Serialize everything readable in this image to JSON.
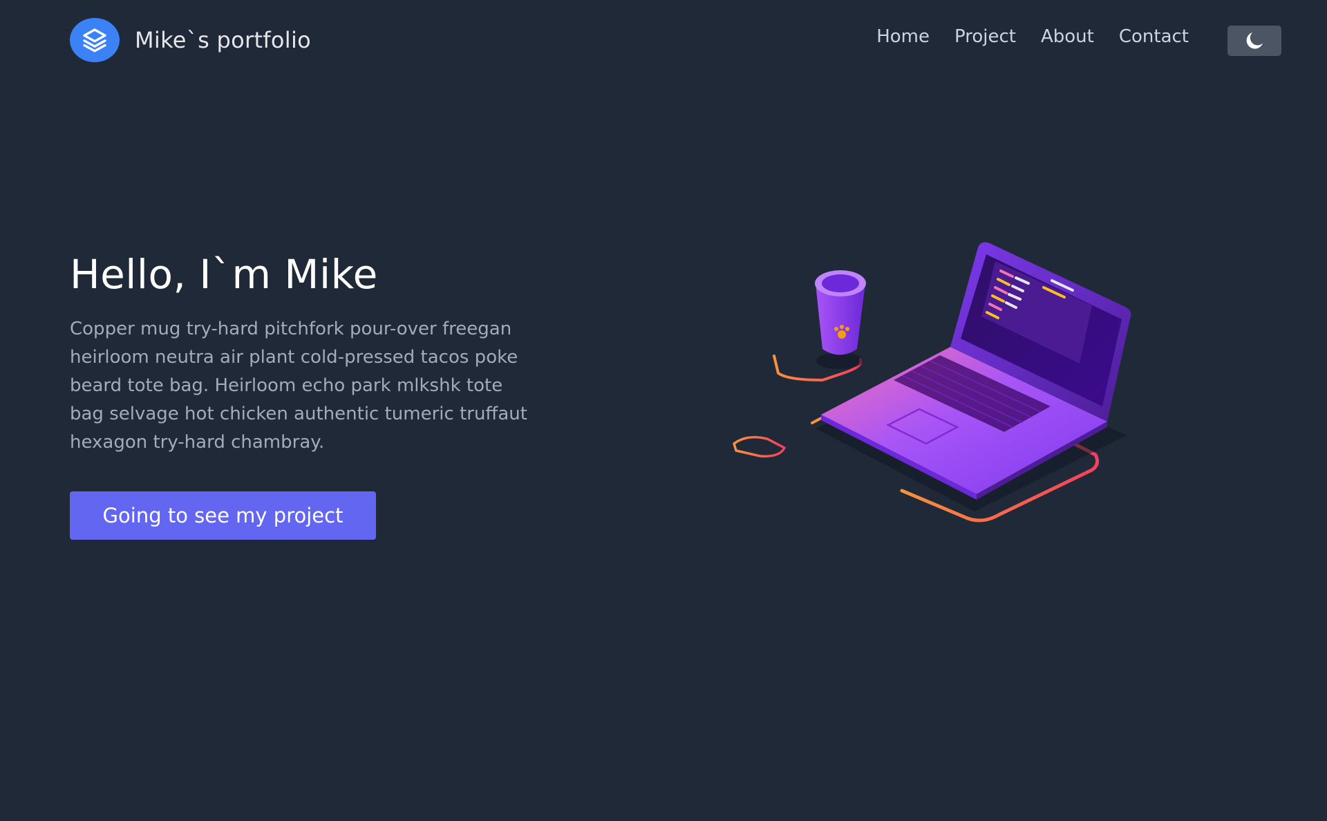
{
  "header": {
    "logo_text": "Mike`s portfolio",
    "nav": [
      "Home",
      "Project",
      "About",
      "Contact"
    ],
    "theme_toggle_icon": "moon-icon"
  },
  "hero": {
    "title": "Hello, I`m Mike",
    "description": "Copper mug try-hard pitchfork pour-over freegan heirloom neutra air plant cold-pressed tacos poke beard tote bag. Heirloom echo park mlkshk tote bag selvage hot chicken authentic tumeric truffaut hexagon try-hard chambray.",
    "cta_label": "Going to see my project",
    "illustration": "laptop-and-coffee-cup-illustration"
  },
  "colors": {
    "background": "#1f2937",
    "logo": "#3b82f6",
    "cta": "#6366f1",
    "toggle": "#4b5563"
  }
}
